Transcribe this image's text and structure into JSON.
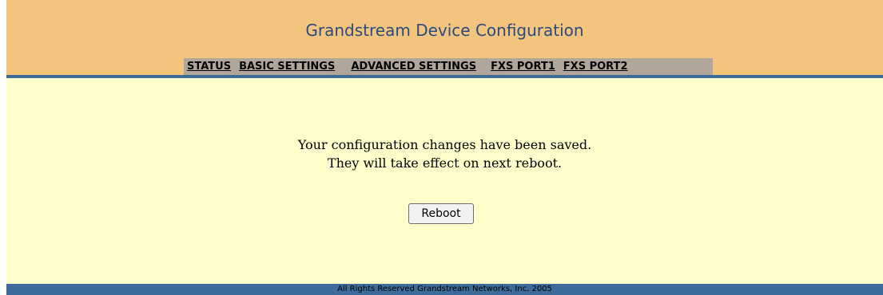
{
  "header": {
    "title": "Grandstream Device Configuration"
  },
  "nav": {
    "items": [
      "STATUS",
      "BASIC SETTINGS",
      "ADVANCED SETTINGS",
      "FXS PORT1",
      "FXS PORT2"
    ]
  },
  "main": {
    "message_line1": "Your configuration changes have been saved.",
    "message_line2": "They will take effect on next reboot.",
    "reboot_label": "Reboot"
  },
  "footer": {
    "text": "All Rights Reserved Grandstream Networks, Inc. 2005"
  },
  "colors": {
    "header_bg": "#f2c47e",
    "nav_bg": "#b0a69a",
    "accent_bar": "#3d6b9a",
    "content_bg": "#ffffcc",
    "title_text": "#2b4a7d"
  }
}
